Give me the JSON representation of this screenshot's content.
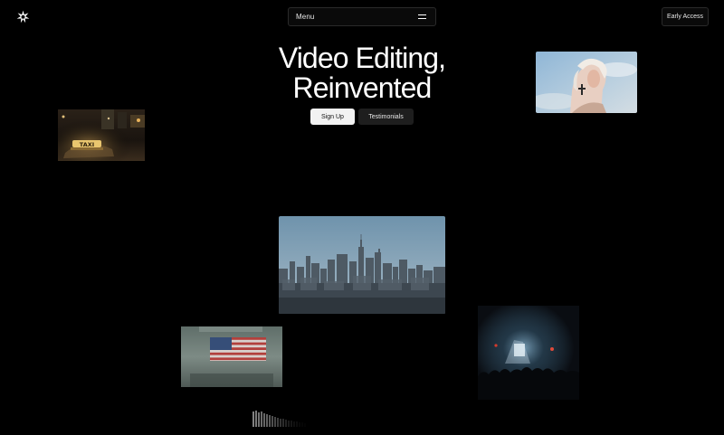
{
  "header": {
    "logo": "asterisk-logo-icon",
    "menu_label": "Menu",
    "menu_icon": "hamburger-icon",
    "early_access_label": "Early Access"
  },
  "hero": {
    "title_line1": "Video Editing,",
    "title_line2": "Reinvented",
    "signup_label": "Sign Up",
    "testimonials_label": "Testimonials"
  },
  "media": [
    {
      "name": "taxi-night-clip"
    },
    {
      "name": "portrait-sky-clip"
    },
    {
      "name": "city-skyline-clip"
    },
    {
      "name": "american-flag-clip"
    },
    {
      "name": "concert-crowd-clip"
    }
  ],
  "colors": {
    "background": "#000000",
    "text": "#ffffff",
    "signup_bg": "#f2f2f2",
    "testimonials_bg": "#1e1e1e",
    "border": "#2a2a2a"
  }
}
